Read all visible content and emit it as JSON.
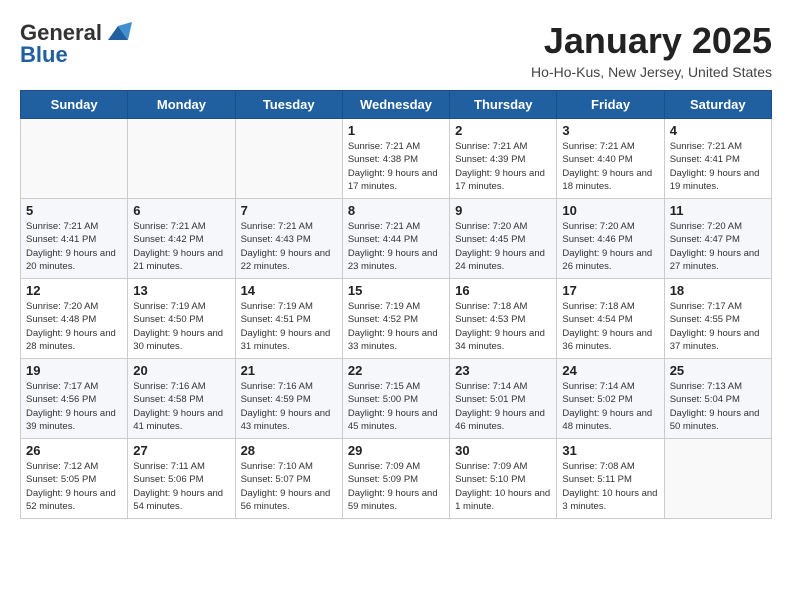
{
  "header": {
    "logo": {
      "general": "General",
      "blue": "Blue"
    },
    "title": "January 2025",
    "location": "Ho-Ho-Kus, New Jersey, United States"
  },
  "days_of_week": [
    "Sunday",
    "Monday",
    "Tuesday",
    "Wednesday",
    "Thursday",
    "Friday",
    "Saturday"
  ],
  "weeks": [
    {
      "days": [
        {
          "number": "",
          "info": ""
        },
        {
          "number": "",
          "info": ""
        },
        {
          "number": "",
          "info": ""
        },
        {
          "number": "1",
          "info": "Sunrise: 7:21 AM\nSunset: 4:38 PM\nDaylight: 9 hours and 17 minutes."
        },
        {
          "number": "2",
          "info": "Sunrise: 7:21 AM\nSunset: 4:39 PM\nDaylight: 9 hours and 17 minutes."
        },
        {
          "number": "3",
          "info": "Sunrise: 7:21 AM\nSunset: 4:40 PM\nDaylight: 9 hours and 18 minutes."
        },
        {
          "number": "4",
          "info": "Sunrise: 7:21 AM\nSunset: 4:41 PM\nDaylight: 9 hours and 19 minutes."
        }
      ]
    },
    {
      "days": [
        {
          "number": "5",
          "info": "Sunrise: 7:21 AM\nSunset: 4:41 PM\nDaylight: 9 hours and 20 minutes."
        },
        {
          "number": "6",
          "info": "Sunrise: 7:21 AM\nSunset: 4:42 PM\nDaylight: 9 hours and 21 minutes."
        },
        {
          "number": "7",
          "info": "Sunrise: 7:21 AM\nSunset: 4:43 PM\nDaylight: 9 hours and 22 minutes."
        },
        {
          "number": "8",
          "info": "Sunrise: 7:21 AM\nSunset: 4:44 PM\nDaylight: 9 hours and 23 minutes."
        },
        {
          "number": "9",
          "info": "Sunrise: 7:20 AM\nSunset: 4:45 PM\nDaylight: 9 hours and 24 minutes."
        },
        {
          "number": "10",
          "info": "Sunrise: 7:20 AM\nSunset: 4:46 PM\nDaylight: 9 hours and 26 minutes."
        },
        {
          "number": "11",
          "info": "Sunrise: 7:20 AM\nSunset: 4:47 PM\nDaylight: 9 hours and 27 minutes."
        }
      ]
    },
    {
      "days": [
        {
          "number": "12",
          "info": "Sunrise: 7:20 AM\nSunset: 4:48 PM\nDaylight: 9 hours and 28 minutes."
        },
        {
          "number": "13",
          "info": "Sunrise: 7:19 AM\nSunset: 4:50 PM\nDaylight: 9 hours and 30 minutes."
        },
        {
          "number": "14",
          "info": "Sunrise: 7:19 AM\nSunset: 4:51 PM\nDaylight: 9 hours and 31 minutes."
        },
        {
          "number": "15",
          "info": "Sunrise: 7:19 AM\nSunset: 4:52 PM\nDaylight: 9 hours and 33 minutes."
        },
        {
          "number": "16",
          "info": "Sunrise: 7:18 AM\nSunset: 4:53 PM\nDaylight: 9 hours and 34 minutes."
        },
        {
          "number": "17",
          "info": "Sunrise: 7:18 AM\nSunset: 4:54 PM\nDaylight: 9 hours and 36 minutes."
        },
        {
          "number": "18",
          "info": "Sunrise: 7:17 AM\nSunset: 4:55 PM\nDaylight: 9 hours and 37 minutes."
        }
      ]
    },
    {
      "days": [
        {
          "number": "19",
          "info": "Sunrise: 7:17 AM\nSunset: 4:56 PM\nDaylight: 9 hours and 39 minutes."
        },
        {
          "number": "20",
          "info": "Sunrise: 7:16 AM\nSunset: 4:58 PM\nDaylight: 9 hours and 41 minutes."
        },
        {
          "number": "21",
          "info": "Sunrise: 7:16 AM\nSunset: 4:59 PM\nDaylight: 9 hours and 43 minutes."
        },
        {
          "number": "22",
          "info": "Sunrise: 7:15 AM\nSunset: 5:00 PM\nDaylight: 9 hours and 45 minutes."
        },
        {
          "number": "23",
          "info": "Sunrise: 7:14 AM\nSunset: 5:01 PM\nDaylight: 9 hours and 46 minutes."
        },
        {
          "number": "24",
          "info": "Sunrise: 7:14 AM\nSunset: 5:02 PM\nDaylight: 9 hours and 48 minutes."
        },
        {
          "number": "25",
          "info": "Sunrise: 7:13 AM\nSunset: 5:04 PM\nDaylight: 9 hours and 50 minutes."
        }
      ]
    },
    {
      "days": [
        {
          "number": "26",
          "info": "Sunrise: 7:12 AM\nSunset: 5:05 PM\nDaylight: 9 hours and 52 minutes."
        },
        {
          "number": "27",
          "info": "Sunrise: 7:11 AM\nSunset: 5:06 PM\nDaylight: 9 hours and 54 minutes."
        },
        {
          "number": "28",
          "info": "Sunrise: 7:10 AM\nSunset: 5:07 PM\nDaylight: 9 hours and 56 minutes."
        },
        {
          "number": "29",
          "info": "Sunrise: 7:09 AM\nSunset: 5:09 PM\nDaylight: 9 hours and 59 minutes."
        },
        {
          "number": "30",
          "info": "Sunrise: 7:09 AM\nSunset: 5:10 PM\nDaylight: 10 hours and 1 minute."
        },
        {
          "number": "31",
          "info": "Sunrise: 7:08 AM\nSunset: 5:11 PM\nDaylight: 10 hours and 3 minutes."
        },
        {
          "number": "",
          "info": ""
        }
      ]
    }
  ]
}
